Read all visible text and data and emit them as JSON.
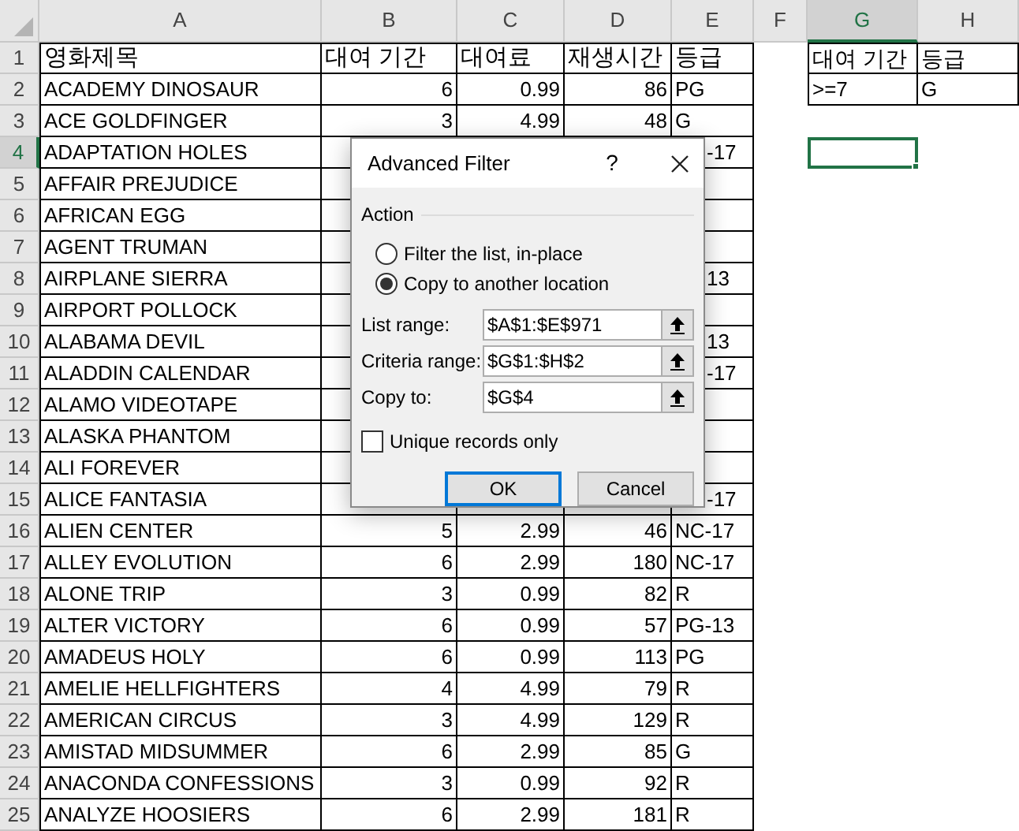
{
  "columns": [
    {
      "label": "A",
      "selected": false
    },
    {
      "label": "B",
      "selected": false
    },
    {
      "label": "C",
      "selected": false
    },
    {
      "label": "D",
      "selected": false
    },
    {
      "label": "E",
      "selected": false
    },
    {
      "label": "F",
      "selected": false
    },
    {
      "label": "G",
      "selected": true
    },
    {
      "label": "H",
      "selected": false
    }
  ],
  "rows": [
    {
      "number": "1",
      "selected": false,
      "kind": "header",
      "title": "영화제목",
      "rental_period": "대여 기간",
      "rental_rate": "대여료",
      "length": "재생시간",
      "rating": "등급",
      "criteria": [
        "대여 기간",
        "등급"
      ]
    },
    {
      "number": "2",
      "selected": false,
      "kind": "data",
      "title": "ACADEMY DINOSAUR",
      "rental_period": "6",
      "rental_rate": "0.99",
      "length": "86",
      "rating": "PG",
      "criteria": [
        ">=7",
        "G"
      ]
    },
    {
      "number": "3",
      "selected": false,
      "kind": "data",
      "title": "ACE GOLDFINGER",
      "rental_period": "3",
      "rental_rate": "4.99",
      "length": "48",
      "rating": "G"
    },
    {
      "number": "4",
      "selected": true,
      "kind": "covered",
      "title": "ADAPTATION HOLES",
      "rating": "-17"
    },
    {
      "number": "5",
      "selected": false,
      "kind": "covered",
      "title": "AFFAIR PREJUDICE"
    },
    {
      "number": "6",
      "selected": false,
      "kind": "covered",
      "title": "AFRICAN EGG"
    },
    {
      "number": "7",
      "selected": false,
      "kind": "covered",
      "title": "AGENT TRUMAN"
    },
    {
      "number": "8",
      "selected": false,
      "kind": "covered",
      "title": "AIRPLANE SIERRA",
      "rating": "13"
    },
    {
      "number": "9",
      "selected": false,
      "kind": "covered",
      "title": "AIRPORT POLLOCK"
    },
    {
      "number": "10",
      "selected": false,
      "kind": "covered",
      "title": "ALABAMA DEVIL",
      "rating": "13"
    },
    {
      "number": "11",
      "selected": false,
      "kind": "covered",
      "title": "ALADDIN CALENDAR",
      "rating": "-17"
    },
    {
      "number": "12",
      "selected": false,
      "kind": "covered",
      "title": "ALAMO VIDEOTAPE"
    },
    {
      "number": "13",
      "selected": false,
      "kind": "covered",
      "title": "ALASKA PHANTOM"
    },
    {
      "number": "14",
      "selected": false,
      "kind": "covered",
      "title": "ALI FOREVER"
    },
    {
      "number": "15",
      "selected": false,
      "kind": "covered",
      "title": "ALICE FANTASIA",
      "rating": "-17"
    },
    {
      "number": "16",
      "selected": false,
      "kind": "data",
      "title": "ALIEN CENTER",
      "rental_period": "5",
      "rental_rate": "2.99",
      "length": "46",
      "rating": "NC-17"
    },
    {
      "number": "17",
      "selected": false,
      "kind": "data",
      "title": "ALLEY EVOLUTION",
      "rental_period": "6",
      "rental_rate": "2.99",
      "length": "180",
      "rating": "NC-17"
    },
    {
      "number": "18",
      "selected": false,
      "kind": "data",
      "title": "ALONE TRIP",
      "rental_period": "3",
      "rental_rate": "0.99",
      "length": "82",
      "rating": "R"
    },
    {
      "number": "19",
      "selected": false,
      "kind": "data",
      "title": "ALTER VICTORY",
      "rental_period": "6",
      "rental_rate": "0.99",
      "length": "57",
      "rating": "PG-13"
    },
    {
      "number": "20",
      "selected": false,
      "kind": "data",
      "title": "AMADEUS HOLY",
      "rental_period": "6",
      "rental_rate": "0.99",
      "length": "113",
      "rating": "PG"
    },
    {
      "number": "21",
      "selected": false,
      "kind": "data",
      "title": "AMELIE HELLFIGHTERS",
      "rental_period": "4",
      "rental_rate": "4.99",
      "length": "79",
      "rating": "R"
    },
    {
      "number": "22",
      "selected": false,
      "kind": "data",
      "title": "AMERICAN CIRCUS",
      "rental_period": "3",
      "rental_rate": "4.99",
      "length": "129",
      "rating": "R"
    },
    {
      "number": "23",
      "selected": false,
      "kind": "data",
      "title": "AMISTAD MIDSUMMER",
      "rental_period": "6",
      "rental_rate": "2.99",
      "length": "85",
      "rating": "G"
    },
    {
      "number": "24",
      "selected": false,
      "kind": "data",
      "title": "ANACONDA CONFESSIONS",
      "rental_period": "3",
      "rental_rate": "0.99",
      "length": "92",
      "rating": "R"
    },
    {
      "number": "25",
      "selected": false,
      "kind": "data",
      "title": "ANALYZE HOOSIERS",
      "rental_period": "6",
      "rental_rate": "2.99",
      "length": "181",
      "rating": "R"
    }
  ],
  "dialog": {
    "title": "Advanced Filter",
    "help": "?",
    "group": "Action",
    "options": [
      {
        "label": "Filter the list, in-place",
        "selected": false
      },
      {
        "label": "Copy to another location",
        "selected": true
      }
    ],
    "fields": [
      {
        "label": "List range:",
        "value": "$A$1:$E$971"
      },
      {
        "label": "Criteria range:",
        "value": "$G$1:$H$2"
      },
      {
        "label": "Copy to:",
        "value": "$G$4"
      }
    ],
    "unique": {
      "label": "Unique records only",
      "checked": false
    },
    "buttons": [
      {
        "label": "OK",
        "default": true
      },
      {
        "label": "Cancel",
        "default": false
      }
    ]
  }
}
